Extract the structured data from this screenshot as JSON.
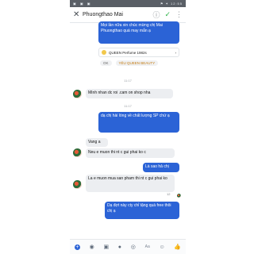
{
  "status": {
    "left": "▣ ▣ ▣",
    "right": "⚑ ✶ 12:55"
  },
  "header": {
    "close": "✕",
    "name": "Phuongthao Mai"
  },
  "messages": {
    "m1": "Mọi lần nữa xin chúc mừng chị Mai Phuongthao quá may mắn ạ",
    "card_label": "QUEEN Perfume 1982s",
    "reactions_ok": "OK",
    "reactions_love": "YÊU QUEEN BEAUTY",
    "time1": "11:17",
    "m2": "Mình nhan dc roi .cam on shop nha",
    "time2": "11:17",
    "m3": "dạ chị hài lòng về chất lượng SP chứ ạ",
    "m4": "Vang a",
    "m5": "Neu e muon thi nt c gui phai ko c",
    "m6": "Là sao hả chị",
    "m7": "La e muon mua san pham thi nt c gui phai ko",
    "m8": "Dạ đợt này cty chỉ tặng quà free thôi chị ạ",
    "seen1": "12"
  },
  "composer": {
    "aa": "Aa"
  },
  "colors": {
    "outgoing": "#2b63d6",
    "incoming": "#eceef1",
    "status": "#5a5f66"
  },
  "icons": [
    "camera-icon",
    "image-icon",
    "mic-icon",
    "sticker-icon",
    "emoji-icon",
    "like-icon",
    "info-icon",
    "check-icon"
  ]
}
